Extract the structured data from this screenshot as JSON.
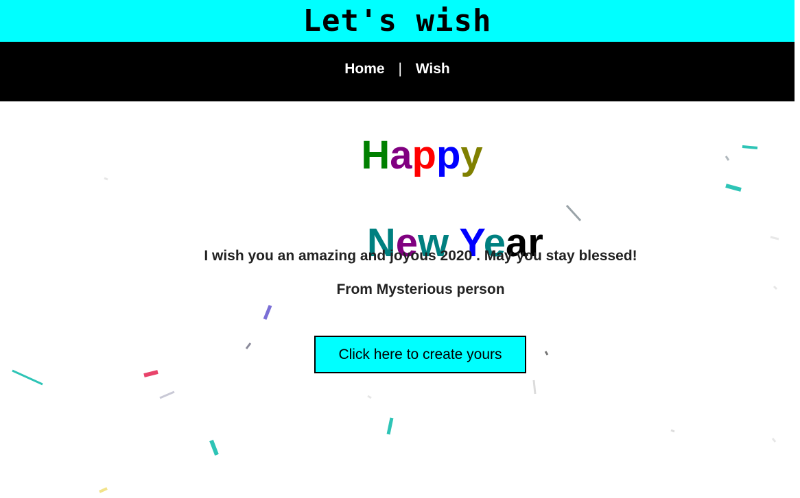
{
  "header": {
    "title": "Let's wish"
  },
  "nav": {
    "items": [
      {
        "label": "Home"
      },
      {
        "label": "Wish"
      }
    ],
    "separator": "|"
  },
  "greeting": {
    "line1": [
      {
        "letter": "H",
        "color": "#008000"
      },
      {
        "letter": "a",
        "color": "#800080"
      },
      {
        "letter": "p",
        "color": "#ff0000"
      },
      {
        "letter": "p",
        "color": "#0000ff"
      },
      {
        "letter": "y",
        "color": "#808000"
      }
    ],
    "line2": [
      {
        "letter": "N",
        "color": "#008080"
      },
      {
        "letter": "e",
        "color": "#800080"
      },
      {
        "letter": "w",
        "color": "#008080"
      },
      {
        "letter": " ",
        "color": "#000000"
      },
      {
        "letter": "Y",
        "color": "#0000ff"
      },
      {
        "letter": "e",
        "color": "#008080"
      },
      {
        "letter": "a",
        "color": "#000000"
      },
      {
        "letter": "r",
        "color": "#000000"
      }
    ]
  },
  "message": {
    "text": "I wish you an amazing and joyous 2020 . May you stay blessed!",
    "from": "From Mysterious person"
  },
  "cta": {
    "label": "Click here to create yours"
  },
  "colors": {
    "header_bg": "#00ffff",
    "nav_bg": "#000000",
    "button_bg": "#00ffff"
  }
}
